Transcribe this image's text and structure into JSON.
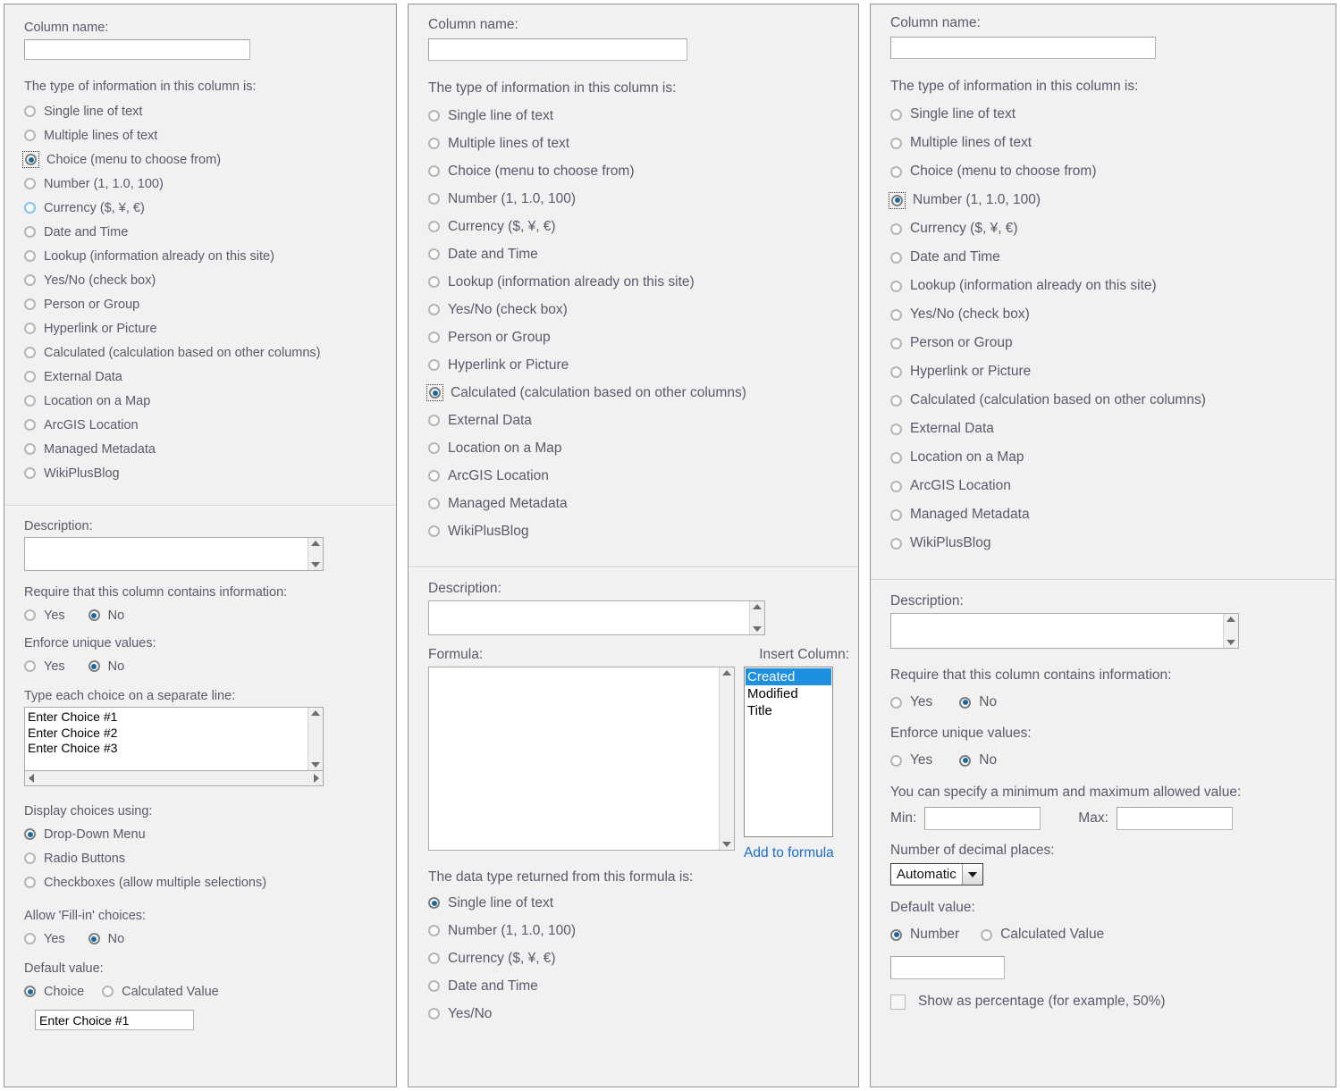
{
  "common": {
    "column_name_label": "Column name:",
    "type_label": "The type of information in this column is:",
    "description_label": "Description:",
    "require_label": "Require that this column contains information:",
    "enforce_label": "Enforce unique values:",
    "yes_label": "Yes",
    "no_label": "No",
    "default_value_label": "Default value:",
    "column_types": [
      "Single line of text",
      "Multiple lines of text",
      "Choice (menu to choose from)",
      "Number (1, 1.0, 100)",
      "Currency ($, ¥, €)",
      "Date and Time",
      "Lookup (information already on this site)",
      "Yes/No (check box)",
      "Person or Group",
      "Hyperlink or Picture",
      "Calculated (calculation based on other columns)",
      "External Data",
      "Location on a Map",
      "ArcGIS Location",
      "Managed Metadata",
      "WikiPlusBlog"
    ]
  },
  "panel1": {
    "column_name_value": "",
    "selected_type_index": 2,
    "hover_type_index": 4,
    "description_value": "",
    "require_selected": "No",
    "enforce_selected": "No",
    "choices_label": "Type each choice on a separate line:",
    "choices_value": "Enter Choice #1\nEnter Choice #2\nEnter Choice #3",
    "display_choices_label": "Display choices using:",
    "display_choices_options": [
      "Drop-Down Menu",
      "Radio Buttons",
      "Checkboxes (allow multiple selections)"
    ],
    "display_choices_selected_index": 0,
    "fill_in_label": "Allow 'Fill-in' choices:",
    "fill_in_selected": "No",
    "default_choice_option": "Choice",
    "default_calculated_option": "Calculated Value",
    "default_selected": "Choice",
    "default_value_text": "Enter Choice #1"
  },
  "panel2": {
    "column_name_value": "",
    "selected_type_index": 10,
    "description_value": "",
    "formula_label": "Formula:",
    "formula_value": "",
    "insert_column_label": "Insert Column:",
    "insert_column_options": [
      "Created",
      "Modified",
      "Title"
    ],
    "insert_column_selected_index": 0,
    "add_to_formula_label": "Add to formula",
    "data_type_label": "The data type returned from this formula is:",
    "data_type_options": [
      "Single line of text",
      "Number (1, 1.0, 100)",
      "Currency ($, ¥, €)",
      "Date and Time",
      "Yes/No"
    ],
    "data_type_selected_index": 0
  },
  "panel3": {
    "column_name_value": "",
    "selected_type_index": 3,
    "description_value": "",
    "require_selected": "No",
    "enforce_selected": "No",
    "minmax_label": "You can specify a minimum and maximum allowed value:",
    "min_label": "Min:",
    "min_value": "",
    "max_label": "Max:",
    "max_value": "",
    "decimal_label": "Number of decimal places:",
    "decimal_selected": "Automatic",
    "default_number_option": "Number",
    "default_calculated_option": "Calculated Value",
    "default_selected": "Number",
    "default_value_text": "",
    "percentage_label": "Show as percentage (for example, 50%)",
    "percentage_checked": false
  },
  "colors": {
    "panel_bg": "#f1f1f1",
    "panel_border": "#949494",
    "label_text": "#5a5a6b",
    "radio_dot": "#18699e",
    "radio_hover_ring": "#7fc6ee",
    "list_selection": "#1e90e0",
    "link": "#1b6ec2"
  }
}
